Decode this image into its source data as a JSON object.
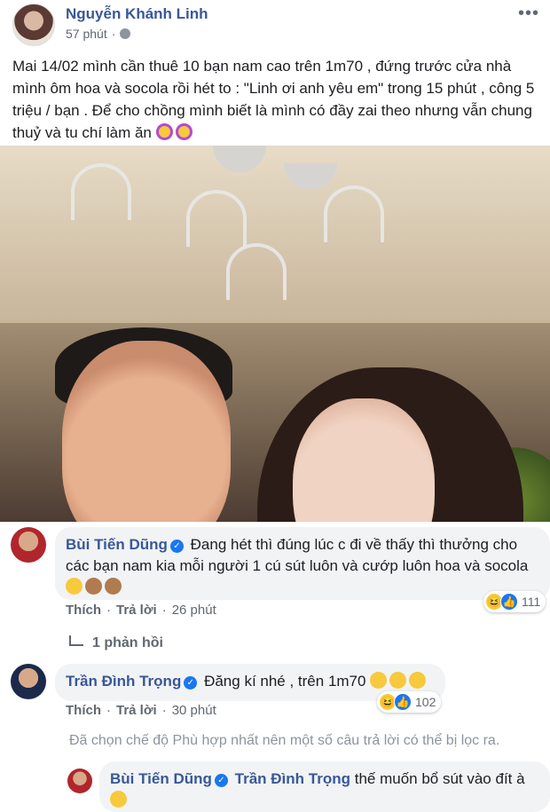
{
  "post": {
    "author": "Nguyễn Khánh Linh",
    "time": "57 phút",
    "text": "Mai 14/02 mình cần thuê 10 bạn nam cao trên 1m70 , đứng trước cửa nhà mình ôm hoa và socola rồi hét to : \"Linh ơi anh yêu em\" trong 15 phút , công 5 triệu / bạn . Để cho chồng mình biết là mình có đầy zai theo nhưng vẫn chung thuỷ và tu chí làm ăn",
    "more_label": "•••",
    "icons": [
      "globe-icon",
      "more-icon"
    ]
  },
  "comments": [
    {
      "name": "Bùi Tiến Dũng",
      "text": "Đang hét thì đúng lúc c đi về thấy thì thưởng cho các bạn nam kia mỗi người 1 cú sút luôn và cướp luôn hoa và socola",
      "reactions": "111",
      "like": "Thích",
      "reply": "Trả lời",
      "time": "26 phút",
      "replies_label": "1 phản hồi"
    },
    {
      "name": "Trần Đình Trọng",
      "text": "Đăng kí nhé , trên 1m70",
      "reactions": "102",
      "like": "Thích",
      "reply": "Trả lời",
      "time": "30 phút"
    }
  ],
  "filter_note": "Đã chọn chế độ Phù hợp nhất nên một số câu trả lời có thể bị lọc ra.",
  "reply": {
    "name": "Bùi Tiến Dũng",
    "mention": "Trần Đình Trọng",
    "text": "thế muốn bổ sút vào đít à"
  }
}
